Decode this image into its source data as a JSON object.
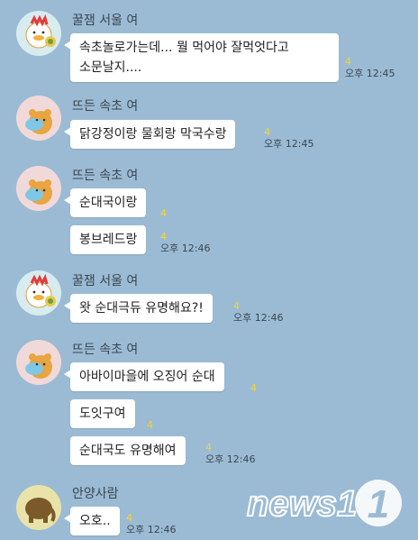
{
  "messages": [
    {
      "sender": "꿀잼 서울 여",
      "avatar": "ryan-chick",
      "text": "속초놀로가는데... 뭘 먹어야 잘먹엇다고\n소문날지....",
      "unread": "4",
      "time": "오후 12:45"
    },
    {
      "sender": "뜨든 속초 여",
      "avatar": "bear-tan",
      "text": "닭강정이랑 물회랑 막국수랑",
      "unread": "4",
      "time": "오후 12:45"
    },
    {
      "sender": "뜨든 속초 여",
      "avatar": "bear-tan",
      "bubbles": [
        {
          "text": "순대국이랑",
          "unread": "4",
          "time": ""
        },
        {
          "text": "봉브레드랑",
          "unread": "4",
          "time": "오후 12:46"
        }
      ]
    },
    {
      "sender": "꿀잼 서울 여",
      "avatar": "ryan-chick",
      "text": "왓 순대극듀 유명해요?!",
      "unread": "4",
      "time": "오후 12:46"
    },
    {
      "sender": "뜨든 속초 여",
      "avatar": "bear-tan",
      "bubbles": [
        {
          "text": "아바이마을에 오징어 순대",
          "unread": "4",
          "time": ""
        },
        {
          "text": "도잇구여",
          "unread": "4",
          "time": ""
        },
        {
          "text": "순대국도 유명해여",
          "unread": "4",
          "time": "오후 12:46"
        }
      ]
    },
    {
      "sender": "안양사람",
      "avatar": "elephant",
      "text": "오호..",
      "unread": "4",
      "time": "오후 12:46"
    }
  ],
  "watermark": "news1"
}
